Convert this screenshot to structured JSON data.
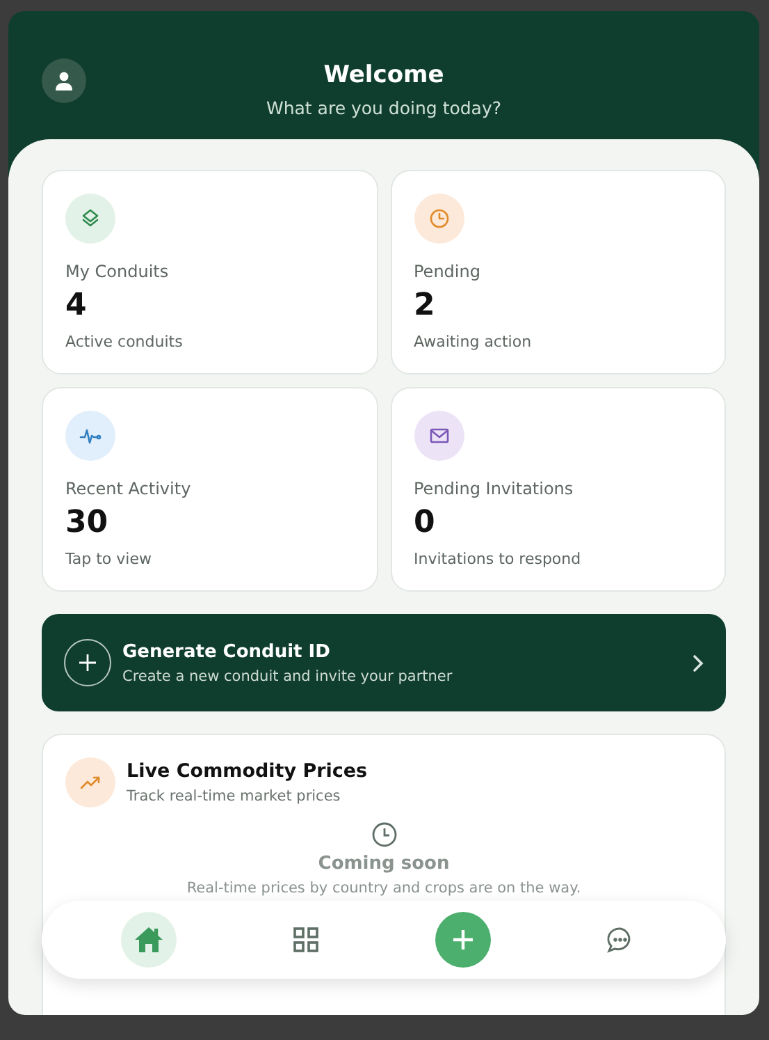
{
  "header": {
    "title": "Welcome",
    "subtitle": "What are you doing today?"
  },
  "stats": [
    {
      "kind": "layers",
      "label": "My Conduits",
      "value": "4",
      "caption": "Active conduits"
    },
    {
      "kind": "clock",
      "label": "Pending",
      "value": "2",
      "caption": "Awaiting action"
    },
    {
      "kind": "activity",
      "label": "Recent Activity",
      "value": "30",
      "caption": "Tap to view"
    },
    {
      "kind": "mail",
      "label": "Pending Invitations",
      "value": "0",
      "caption": "Invitations to respond"
    }
  ],
  "action_banner": {
    "title": "Generate Conduit ID",
    "subtitle": "Create a new conduit and invite your partner"
  },
  "commodity_card": {
    "title": "Live Commodity Prices",
    "subtitle": "Track real-time market prices",
    "empty_title": "Coming soon",
    "empty_text": "Real-time prices by country and crops are on the way."
  },
  "nav": [
    {
      "kind": "home",
      "selected": true
    },
    {
      "kind": "grid",
      "selected": false
    },
    {
      "kind": "add",
      "selected": false
    },
    {
      "kind": "chat",
      "selected": false
    }
  ]
}
